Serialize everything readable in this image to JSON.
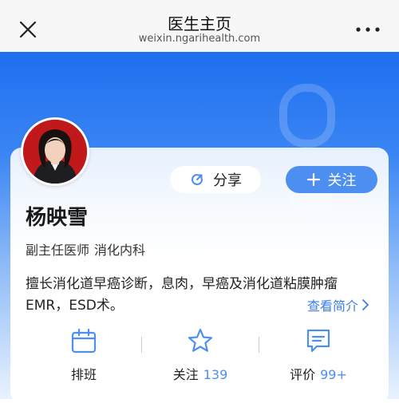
{
  "topbar": {
    "title": "医生主页",
    "url": "weixin.ngarihealth.com",
    "close_icon": "close-icon",
    "more_icon": "more-icon"
  },
  "doctor": {
    "name": "杨映雪",
    "title": "副主任医师",
    "department": "消化内科",
    "specialty": "擅长消化道早癌诊断，息肉，早癌及消化道粘膜肿瘤EMR，ESD术。"
  },
  "actions": {
    "share_label": "分享",
    "follow_label": "关注"
  },
  "profile_link": "查看简介",
  "stats": {
    "schedule_label": "排班",
    "follow_label": "关注",
    "follow_count": "139",
    "review_label": "评价",
    "review_count": "99+"
  },
  "colors": {
    "brand_blue": "#1f6ff0",
    "accent": "#4d8ff0",
    "link": "#3a7ee8"
  }
}
